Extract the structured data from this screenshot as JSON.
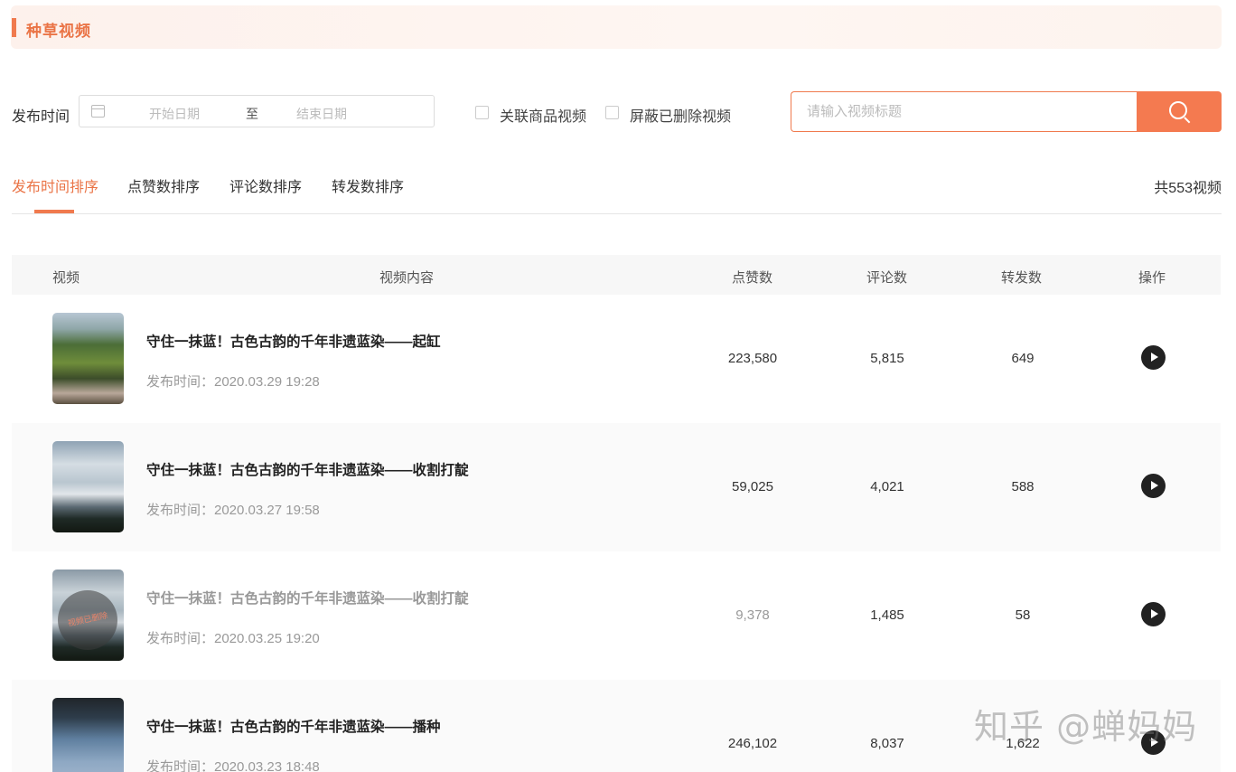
{
  "section": {
    "title": "种草视频"
  },
  "filters": {
    "time_label": "发布时间",
    "start_placeholder": "开始日期",
    "range_sep": "至",
    "end_placeholder": "结束日期",
    "checkbox_related": "关联商品视频",
    "checkbox_hide_deleted": "屏蔽已删除视频",
    "search_placeholder": "请输入视频标题"
  },
  "tabs": [
    {
      "label": "发布时间排序",
      "active": true
    },
    {
      "label": "点赞数排序",
      "active": false
    },
    {
      "label": "评论数排序",
      "active": false
    },
    {
      "label": "转发数排序",
      "active": false
    }
  ],
  "total_label": "共553视频",
  "table": {
    "headers": [
      "视频",
      "视频内容",
      "点赞数",
      "评论数",
      "转发数",
      "操作"
    ],
    "rows": [
      {
        "title": "守住一抹蓝！古色古韵的千年非遗蓝染——起缸",
        "time": "发布时间：2020.03.29 19:28",
        "likes": "223,580",
        "comments": "5,815",
        "shares": "649",
        "deleted": false
      },
      {
        "title": "守住一抹蓝！古色古韵的千年非遗蓝染——收割打靛",
        "time": "发布时间：2020.03.27 19:58",
        "likes": "59,025",
        "comments": "4,021",
        "shares": "588",
        "deleted": false
      },
      {
        "title": "守住一抹蓝！古色古韵的千年非遗蓝染——收割打靛",
        "time": "发布时间：2020.03.25 19:20",
        "likes": "9,378",
        "comments": "1,485",
        "shares": "58",
        "deleted": true,
        "deleted_label": "视频已删除"
      },
      {
        "title": "守住一抹蓝！古色古韵的千年非遗蓝染——播种",
        "time": "发布时间：2020.03.23 18:48",
        "likes": "246,102",
        "comments": "8,037",
        "shares": "1,622",
        "deleted": false
      }
    ]
  },
  "watermark": "知乎 @蝉妈妈",
  "colors": {
    "accent": "#f07a4e",
    "header_bg": "#fdf1ec"
  }
}
